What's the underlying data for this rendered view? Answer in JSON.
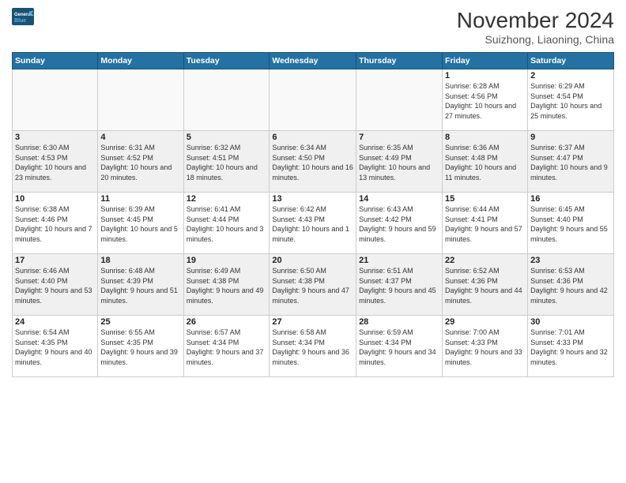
{
  "header": {
    "logo_line1": "General",
    "logo_line2": "Blue",
    "month": "November 2024",
    "location": "Suizhong, Liaoning, China"
  },
  "days_of_week": [
    "Sunday",
    "Monday",
    "Tuesday",
    "Wednesday",
    "Thursday",
    "Friday",
    "Saturday"
  ],
  "weeks": [
    [
      {
        "day": "",
        "info": ""
      },
      {
        "day": "",
        "info": ""
      },
      {
        "day": "",
        "info": ""
      },
      {
        "day": "",
        "info": ""
      },
      {
        "day": "",
        "info": ""
      },
      {
        "day": "1",
        "info": "Sunrise: 6:28 AM\nSunset: 4:56 PM\nDaylight: 10 hours and 27 minutes."
      },
      {
        "day": "2",
        "info": "Sunrise: 6:29 AM\nSunset: 4:54 PM\nDaylight: 10 hours and 25 minutes."
      }
    ],
    [
      {
        "day": "3",
        "info": "Sunrise: 6:30 AM\nSunset: 4:53 PM\nDaylight: 10 hours and 23 minutes."
      },
      {
        "day": "4",
        "info": "Sunrise: 6:31 AM\nSunset: 4:52 PM\nDaylight: 10 hours and 20 minutes."
      },
      {
        "day": "5",
        "info": "Sunrise: 6:32 AM\nSunset: 4:51 PM\nDaylight: 10 hours and 18 minutes."
      },
      {
        "day": "6",
        "info": "Sunrise: 6:34 AM\nSunset: 4:50 PM\nDaylight: 10 hours and 16 minutes."
      },
      {
        "day": "7",
        "info": "Sunrise: 6:35 AM\nSunset: 4:49 PM\nDaylight: 10 hours and 13 minutes."
      },
      {
        "day": "8",
        "info": "Sunrise: 6:36 AM\nSunset: 4:48 PM\nDaylight: 10 hours and 11 minutes."
      },
      {
        "day": "9",
        "info": "Sunrise: 6:37 AM\nSunset: 4:47 PM\nDaylight: 10 hours and 9 minutes."
      }
    ],
    [
      {
        "day": "10",
        "info": "Sunrise: 6:38 AM\nSunset: 4:46 PM\nDaylight: 10 hours and 7 minutes."
      },
      {
        "day": "11",
        "info": "Sunrise: 6:39 AM\nSunset: 4:45 PM\nDaylight: 10 hours and 5 minutes."
      },
      {
        "day": "12",
        "info": "Sunrise: 6:41 AM\nSunset: 4:44 PM\nDaylight: 10 hours and 3 minutes."
      },
      {
        "day": "13",
        "info": "Sunrise: 6:42 AM\nSunset: 4:43 PM\nDaylight: 10 hours and 1 minute."
      },
      {
        "day": "14",
        "info": "Sunrise: 6:43 AM\nSunset: 4:42 PM\nDaylight: 9 hours and 59 minutes."
      },
      {
        "day": "15",
        "info": "Sunrise: 6:44 AM\nSunset: 4:41 PM\nDaylight: 9 hours and 57 minutes."
      },
      {
        "day": "16",
        "info": "Sunrise: 6:45 AM\nSunset: 4:40 PM\nDaylight: 9 hours and 55 minutes."
      }
    ],
    [
      {
        "day": "17",
        "info": "Sunrise: 6:46 AM\nSunset: 4:40 PM\nDaylight: 9 hours and 53 minutes."
      },
      {
        "day": "18",
        "info": "Sunrise: 6:48 AM\nSunset: 4:39 PM\nDaylight: 9 hours and 51 minutes."
      },
      {
        "day": "19",
        "info": "Sunrise: 6:49 AM\nSunset: 4:38 PM\nDaylight: 9 hours and 49 minutes."
      },
      {
        "day": "20",
        "info": "Sunrise: 6:50 AM\nSunset: 4:38 PM\nDaylight: 9 hours and 47 minutes."
      },
      {
        "day": "21",
        "info": "Sunrise: 6:51 AM\nSunset: 4:37 PM\nDaylight: 9 hours and 45 minutes."
      },
      {
        "day": "22",
        "info": "Sunrise: 6:52 AM\nSunset: 4:36 PM\nDaylight: 9 hours and 44 minutes."
      },
      {
        "day": "23",
        "info": "Sunrise: 6:53 AM\nSunset: 4:36 PM\nDaylight: 9 hours and 42 minutes."
      }
    ],
    [
      {
        "day": "24",
        "info": "Sunrise: 6:54 AM\nSunset: 4:35 PM\nDaylight: 9 hours and 40 minutes."
      },
      {
        "day": "25",
        "info": "Sunrise: 6:55 AM\nSunset: 4:35 PM\nDaylight: 9 hours and 39 minutes."
      },
      {
        "day": "26",
        "info": "Sunrise: 6:57 AM\nSunset: 4:34 PM\nDaylight: 9 hours and 37 minutes."
      },
      {
        "day": "27",
        "info": "Sunrise: 6:58 AM\nSunset: 4:34 PM\nDaylight: 9 hours and 36 minutes."
      },
      {
        "day": "28",
        "info": "Sunrise: 6:59 AM\nSunset: 4:34 PM\nDaylight: 9 hours and 34 minutes."
      },
      {
        "day": "29",
        "info": "Sunrise: 7:00 AM\nSunset: 4:33 PM\nDaylight: 9 hours and 33 minutes."
      },
      {
        "day": "30",
        "info": "Sunrise: 7:01 AM\nSunset: 4:33 PM\nDaylight: 9 hours and 32 minutes."
      }
    ]
  ]
}
